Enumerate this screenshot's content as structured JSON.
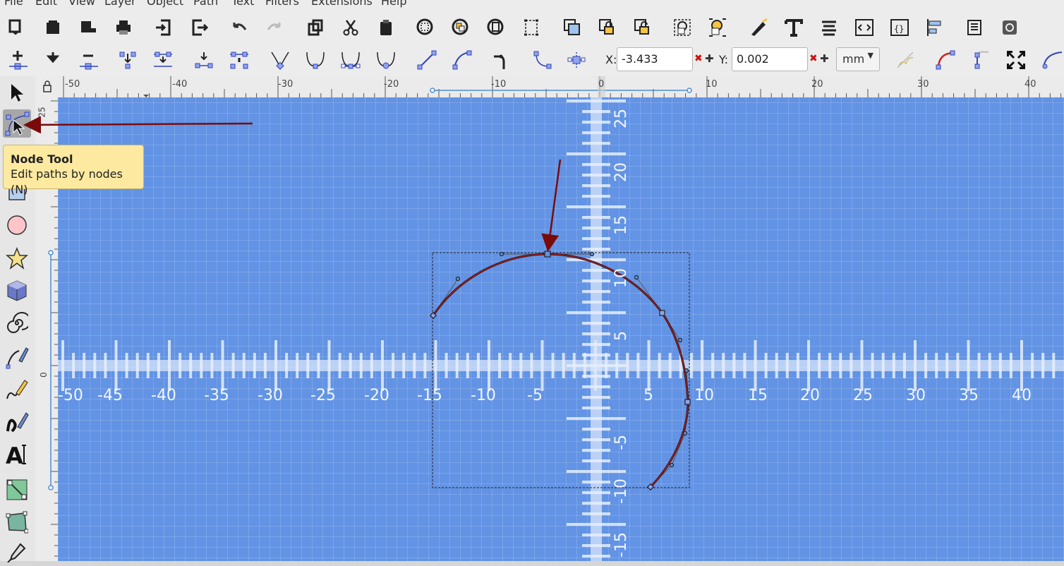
{
  "menu": {
    "items": [
      "File",
      "Edit",
      "View",
      "Layer",
      "Object",
      "Path",
      "Text",
      "Filters",
      "Extensions",
      "Help"
    ]
  },
  "toolbar": {
    "commands": [
      "new-document-icon",
      "open-icon",
      "open-recent-icon",
      "print-icon",
      "import-icon",
      "export-icon",
      "undo-icon",
      "redo-icon",
      "duplicate-icon",
      "cut-icon",
      "paste-icon",
      "zoom-selection-icon",
      "zoom-drawing-icon",
      "zoom-page-icon",
      "fit-width-icon",
      "raise-icon",
      "lock-icon",
      "unlock-icon",
      "group-icon",
      "ungroup-icon",
      "fill-stroke-icon",
      "text-font-icon",
      "align-text-icon",
      "xml-editor-icon",
      "css-editor-icon",
      "align-distribute-icon",
      "document-properties-icon",
      "preferences-icon"
    ],
    "node_controls": [
      "insert-node-icon",
      "delete-node-icon",
      "remove-segment-icon",
      "join-nodes-icon",
      "join-segment-icon",
      "break-path-icon",
      "delete-segment-icon",
      "make-cusp-icon",
      "make-smooth-icon",
      "make-symmetric-icon",
      "make-auto-smooth-icon",
      "make-line-icon",
      "make-curve-icon",
      "object-to-path-icon",
      "stroke-to-path-icon",
      "path-effects-icon",
      "show-transform-handles-icon",
      "show-bezier-handles-icon",
      "show-outline-icon",
      "show-clip-icon",
      "zoom-fit-icon",
      "spiro-icon"
    ]
  },
  "coords": {
    "x_label": "X:",
    "x_value": "-3.433",
    "y_label": "Y:",
    "y_value": "0.002",
    "unit": "mm",
    "clear_mark": "✖",
    "plus_mark": "✚"
  },
  "tools": [
    "selector-tool-icon",
    "node-tool-icon",
    "zoom-tool-icon",
    "rect-tool-icon",
    "ellipse-tool-icon",
    "star-tool-icon",
    "box3d-tool-icon",
    "spiral-tool-icon",
    "pen-tool-icon",
    "pencil-tool-icon",
    "calligraphy-tool-icon",
    "text-tool-icon",
    "gradient-tool-icon",
    "mesh-tool-icon",
    "dropper-tool-icon"
  ],
  "tooltip": {
    "title": "Node Tool",
    "description": "Edit paths by nodes (N)"
  },
  "ruler": {
    "top_labels": [
      "-50",
      "-40",
      "-30",
      "-20",
      "-10",
      "0",
      "10",
      "20",
      "30",
      "40"
    ],
    "left_labels": [
      "25",
      "0"
    ]
  },
  "canvas": {
    "x_axis_labels": [
      "-50",
      "-45",
      "-40",
      "-35",
      "-30",
      "-25",
      "-20",
      "-15",
      "-10",
      "-5",
      "5",
      "10",
      "15",
      "20",
      "25",
      "30",
      "35",
      "40"
    ],
    "y_axis_labels": [
      "25",
      "20",
      "15",
      "10",
      "5",
      "-5",
      "-10",
      "-15"
    ]
  },
  "colors": {
    "canvas_bg": "#6293e4",
    "arrow": "#7a0b0b",
    "path": "#4a0d0d",
    "tooltip_bg": "#fde9a0"
  }
}
